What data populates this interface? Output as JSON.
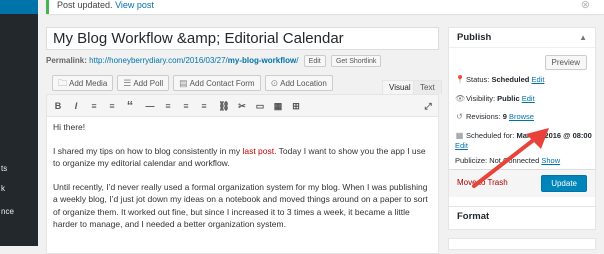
{
  "sidebar": {
    "items": [
      {
        "label": ""
      },
      {
        "label": "ts"
      },
      {
        "label": "k"
      },
      {
        "label": "nce"
      }
    ]
  },
  "notice": {
    "text": "Post updated.",
    "link": "View post",
    "dismiss": "⊗"
  },
  "post": {
    "title": "My Blog Workflow &amp; Editorial Calendar",
    "permalink_label": "Permalink:",
    "permalink_base": "http://honeyberrydiary.com/2016/03/27/",
    "permalink_slug": "my-blog-workflow",
    "permalink_end": "/",
    "edit_button": "Edit",
    "shortlink_button": "Get Shortlink"
  },
  "media_buttons": [
    {
      "icon": "🗀",
      "label": "Add Media"
    },
    {
      "icon": "☰",
      "label": "Add Poll"
    },
    {
      "icon": "▤",
      "label": "Add Contact Form"
    },
    {
      "icon": "⊙",
      "label": "Add Location"
    }
  ],
  "editor_tabs": {
    "visual": "Visual",
    "text": "Text"
  },
  "toolbar_icons": [
    "B",
    "I",
    "≡",
    "≡",
    "“",
    "—",
    "≡",
    "≡",
    "≡",
    "⛓",
    "✂",
    "▭",
    "▦",
    "⊞",
    "⤢"
  ],
  "content": {
    "p1": "Hi there!",
    "p2_before": "I shared my tips on how to blog consistently in my ",
    "p2_link": "last post",
    "p2_after": ". Today I want to show you the app I use to organize my editorial calendar and workflow.",
    "p3": "Until recently, I’d never really used a formal organization system for my blog. When I was publishing a weekly blog, I’d just jot down my ideas on a notebook and moved things around on a paper to sort of organize them. It worked out fine, but since I increased it to 3 times a week, it became a little harder to manage, and I needed a better organization system."
  },
  "publish": {
    "title": "Publish",
    "preview": "Preview",
    "status_label": "Status:",
    "status_value": "Scheduled",
    "visibility_label": "Visibility:",
    "visibility_value": "Public",
    "revisions_label": "Revisions:",
    "revisions_value": "9",
    "revisions_link": "Browse",
    "scheduled_label": "Scheduled for:",
    "scheduled_value": "Mar 27, 2016 @ 08:00",
    "edit": "Edit",
    "publicize_label": "Publicize:",
    "publicize_value": "Not Connected",
    "show": "Show",
    "trash": "Move to Trash",
    "update": "Update"
  },
  "format_box": {
    "title": "Format"
  },
  "colors": {
    "accent": "#0085ba",
    "link": "#0073aa",
    "annotation_arrow": "#e8433a",
    "sidebar": "#23282d"
  }
}
